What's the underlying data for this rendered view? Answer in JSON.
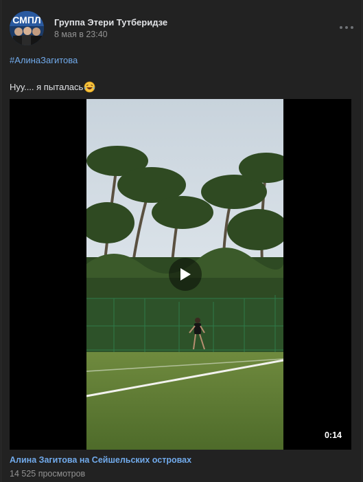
{
  "post": {
    "owner_name": "Группа Этери Тутберидзе",
    "date": "8 мая в 23:40",
    "avatar_text": "СМПЛ",
    "hashtag": "#АлинаЗагитова",
    "text": "Нуу.... я пыталась",
    "text_emoji": "laughing-crying-emoji"
  },
  "video": {
    "title": "Алина Загитова на Сейшельских островах",
    "duration": "0:14",
    "views": "14 525 просмотров",
    "play_icon": "play-icon"
  },
  "colors": {
    "background": "#222222",
    "link": "#71aaeb",
    "text": "#e1e3e6",
    "secondary": "#939393"
  }
}
